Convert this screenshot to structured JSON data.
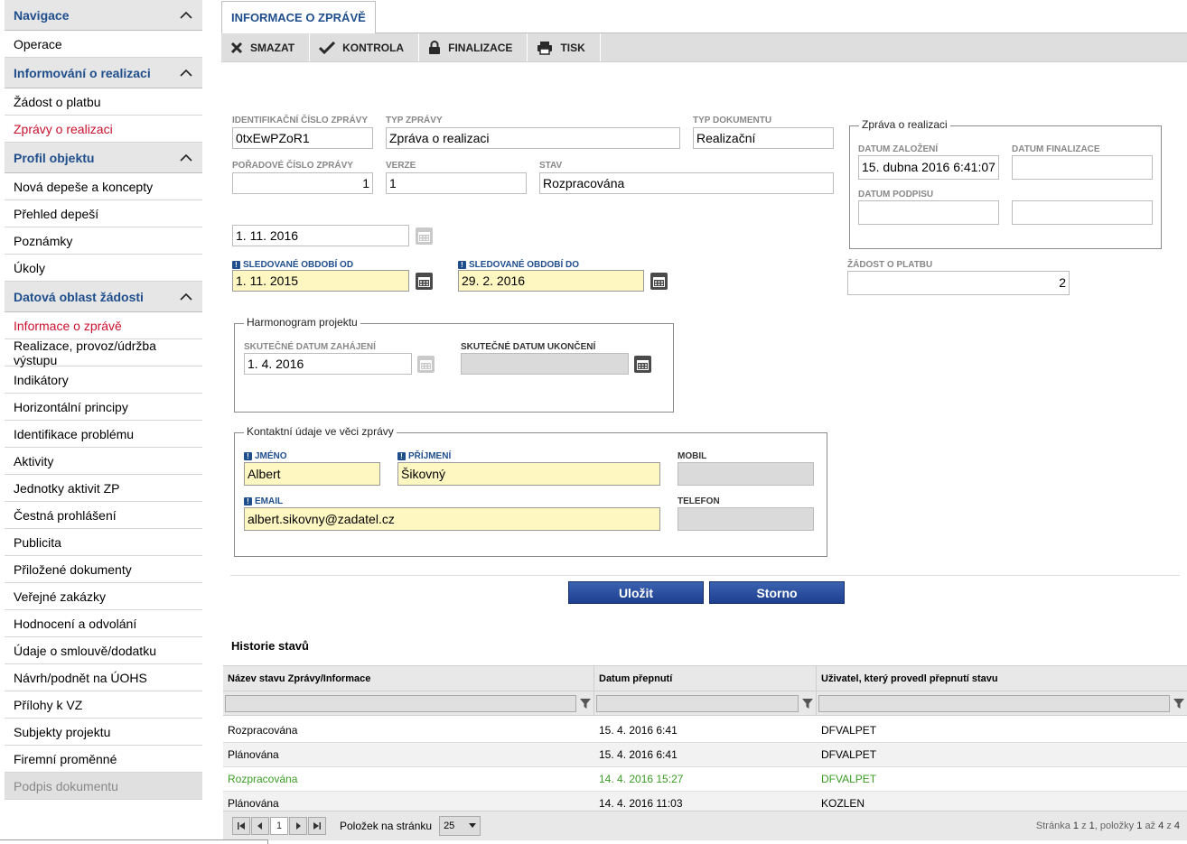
{
  "sidebar": {
    "sections": [
      {
        "title": "Navigace",
        "items": [
          "Operace"
        ]
      },
      {
        "title": "Informování o realizaci",
        "items": [
          "Žádost o platbu",
          "Zprávy o realizaci"
        ]
      },
      {
        "title": "Profil objektu",
        "items": [
          "Nová depeše a koncepty",
          "Přehled depeší",
          "Poznámky",
          "Úkoly"
        ]
      },
      {
        "title": "Datová oblast žádosti",
        "items": [
          "Informace o zprávě",
          "Realizace, provoz/údržba výstupu",
          "Indikátory",
          "Horizontální principy",
          "Identifikace problému",
          "Aktivity",
          "Jednotky aktivit ZP",
          "Čestná prohlášení",
          "Publicita",
          "Přiložené dokumenty",
          "Veřejné zakázky",
          "Hodnocení a odvolání",
          "Údaje o smlouvě/dodatku",
          "Návrh/podnět na ÚOHS",
          "Přílohy k VZ",
          "Subjekty projektu",
          "Firemní proměnné",
          "Podpis dokumentu"
        ]
      }
    ]
  },
  "tab": {
    "label": "INFORMACE O ZPRÁVĚ"
  },
  "toolbar": {
    "smazat": "SMAZAT",
    "kontrola": "KONTROLA",
    "finalizace": "FINALIZACE",
    "tisk": "TISK"
  },
  "form": {
    "id_label": "IDENTIFIKAČNÍ ČÍSLO ZPRÁVY",
    "id_value": "0txEwPZoR1",
    "typ_zpravy_label": "TYP ZPRÁVY",
    "typ_zpravy_value": "Zpráva o realizaci",
    "typ_dokumentu_label": "TYP DOKUMENTU",
    "typ_dokumentu_value": "Realizační",
    "poradove_label": "POŘADOVÉ ČÍSLO ZPRÁVY",
    "poradove_value": "1",
    "verze_label": "VERZE",
    "verze_value": "1",
    "stav_label": "STAV",
    "stav_value": "Rozpracována",
    "date_value": "1. 11. 2016",
    "od_label": "SLEDOVANÉ OBDOBÍ OD",
    "od_value": "1. 11. 2015",
    "do_label": "SLEDOVANÉ OBDOBÍ DO",
    "do_value": "29. 2. 2016",
    "zadost_label": "ŽÁDOST O PLATBU",
    "zadost_value": "2"
  },
  "zprava_group": {
    "legend": "Zpráva o realizaci",
    "zalozeni_label": "DATUM ZALOŽENÍ",
    "zalozeni_value": "15. dubna 2016 6:41:07",
    "finalizace_label": "DATUM FINALIZACE",
    "finalizace_value": "",
    "podpisu_label": "DATUM PODPISU",
    "podpisu_value": ""
  },
  "harmonogram": {
    "legend": "Harmonogram projektu",
    "zahajeni_label": "SKUTEČNÉ DATUM ZAHÁJENÍ",
    "zahajeni_value": "1. 4. 2016",
    "ukonceni_label": "SKUTEČNÉ DATUM UKONČENÍ",
    "ukonceni_value": ""
  },
  "kontakt": {
    "legend": "Kontaktní údaje ve věci zprávy",
    "jmeno_label": "JMÉNO",
    "jmeno_value": "Albert",
    "prijmeni_label": "PŘÍJMENÍ",
    "prijmeni_value": "Šikovný",
    "mobil_label": "MOBIL",
    "mobil_value": "",
    "email_label": "EMAIL",
    "email_value": "albert.sikovny@zadatel.cz",
    "telefon_label": "TELEFON",
    "telefon_value": ""
  },
  "buttons": {
    "ulozit": "Uložit",
    "storno": "Storno"
  },
  "history": {
    "title": "Historie stavů",
    "columns": [
      "Název stavu Zprávy/Informace",
      "Datum přepnutí",
      "Uživatel, který provedl přepnutí stavu"
    ],
    "rows": [
      [
        "Rozpracována",
        "15. 4. 2016 6:41",
        "DFVALPET"
      ],
      [
        "Plánována",
        "15. 4. 2016 6:41",
        "DFVALPET"
      ],
      [
        "Rozpracována",
        "14. 4. 2016 15:27",
        "DFVALPET"
      ],
      [
        "Plánována",
        "14. 4. 2016 11:03",
        "KOZLEN"
      ]
    ]
  },
  "pager": {
    "current_page": "1",
    "per_page_label": "Položek na stránku",
    "per_page": "25",
    "info_prefix": "Stránka",
    "page": "1",
    "of1": "z",
    "pages": "1",
    "items_prefix": ", položky",
    "from": "1",
    "to_word": "až",
    "to": "4",
    "of2": "z",
    "total": "4"
  },
  "colors": {
    "accent": "#1f4e8c",
    "active_red": "#c8102e",
    "required_bg": "#fff7c2",
    "green_row": "#3a9d23"
  }
}
